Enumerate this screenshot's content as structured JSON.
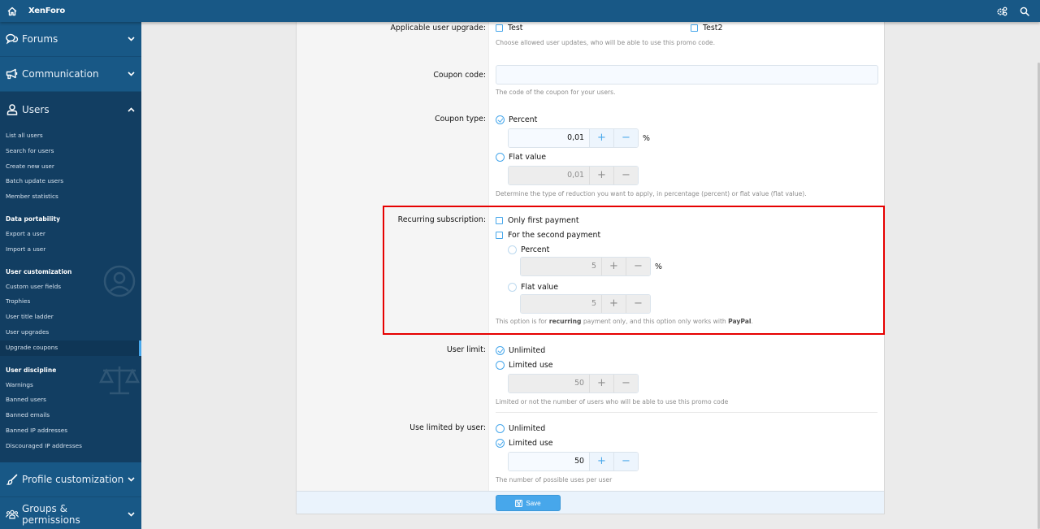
{
  "topbar": {
    "brand": "XenForo",
    "home_icon": "home-icon",
    "icons": [
      "cogs-icon",
      "search-icon"
    ]
  },
  "sidebar": {
    "sections": [
      {
        "label": "Forums",
        "icon": "comments-icon",
        "expanded": false
      },
      {
        "label": "Communication",
        "icon": "bullhorn-icon",
        "expanded": false
      },
      {
        "label": "Users",
        "icon": "user-icon",
        "expanded": true
      },
      {
        "label": "Profile customization",
        "icon": "brush-icon",
        "expanded": false
      },
      {
        "label": "Groups & permissions",
        "icon": "users-icon",
        "expanded": false
      }
    ],
    "users_menu": {
      "items": [
        "List all users",
        "Search for users",
        "Create new user",
        "Batch update users",
        "Member statistics"
      ],
      "data_portability": {
        "heading": "Data portability",
        "items": [
          "Export a user",
          "Import a user"
        ]
      },
      "user_customization": {
        "heading": "User customization",
        "items": [
          "Custom user fields",
          "Trophies",
          "User title ladder",
          "User upgrades",
          "Upgrade coupons"
        ]
      },
      "user_discipline": {
        "heading": "User discipline",
        "items": [
          "Warnings",
          "Banned users",
          "Banned emails",
          "Banned IP addresses",
          "Discouraged IP addresses"
        ]
      },
      "selected": "Upgrade coupons"
    }
  },
  "form": {
    "applicable_upgrade": {
      "label": "Applicable user upgrade:",
      "options": [
        {
          "label": "Test",
          "checked": false
        },
        {
          "label": "Test2",
          "checked": false
        }
      ],
      "help": "Choose allowed user updates, who will be able to use this promo code."
    },
    "coupon_code": {
      "label": "Coupon code:",
      "value": "",
      "help": "The code of the coupon for your users."
    },
    "coupon_type": {
      "label": "Coupon type:",
      "percent": {
        "label": "Percent",
        "checked": true,
        "value": "0,01",
        "unit": "%"
      },
      "flat": {
        "label": "Flat value",
        "checked": false,
        "value": "0,01"
      },
      "help": "Determine the type of reduction you want to apply, in percentage (percent) or flat value (flat value)."
    },
    "recurring": {
      "label": "Recurring subscription:",
      "only_first": {
        "label": "Only first payment",
        "checked": false
      },
      "second": {
        "label": "For the second payment",
        "checked": false
      },
      "percent": {
        "label": "Percent",
        "checked": false,
        "value": "5",
        "unit": "%"
      },
      "flat": {
        "label": "Flat value",
        "checked": false,
        "value": "5"
      },
      "help_pre": "This option is for ",
      "help_bold1": "recurring",
      "help_mid": " payment only, and this option only works with ",
      "help_bold2": "PayPal",
      "help_post": "."
    },
    "user_limit": {
      "label": "User limit:",
      "unlimited": {
        "label": "Unlimited",
        "checked": true
      },
      "limited": {
        "label": "Limited use",
        "checked": false,
        "value": "50"
      },
      "help": "Limited or not the number of users who will be able to use this promo code"
    },
    "per_user": {
      "label": "Use limited by user:",
      "unlimited": {
        "label": "Unlimited",
        "checked": false
      },
      "limited": {
        "label": "Limited use",
        "checked": true,
        "value": "50"
      },
      "help": "The number of possible uses per user"
    },
    "spinner_plus": "+",
    "spinner_minus": "−",
    "save_label": "Save"
  },
  "colors": {
    "brand": "#185886",
    "accent": "#47a7eb",
    "highlight": "#e60000"
  }
}
